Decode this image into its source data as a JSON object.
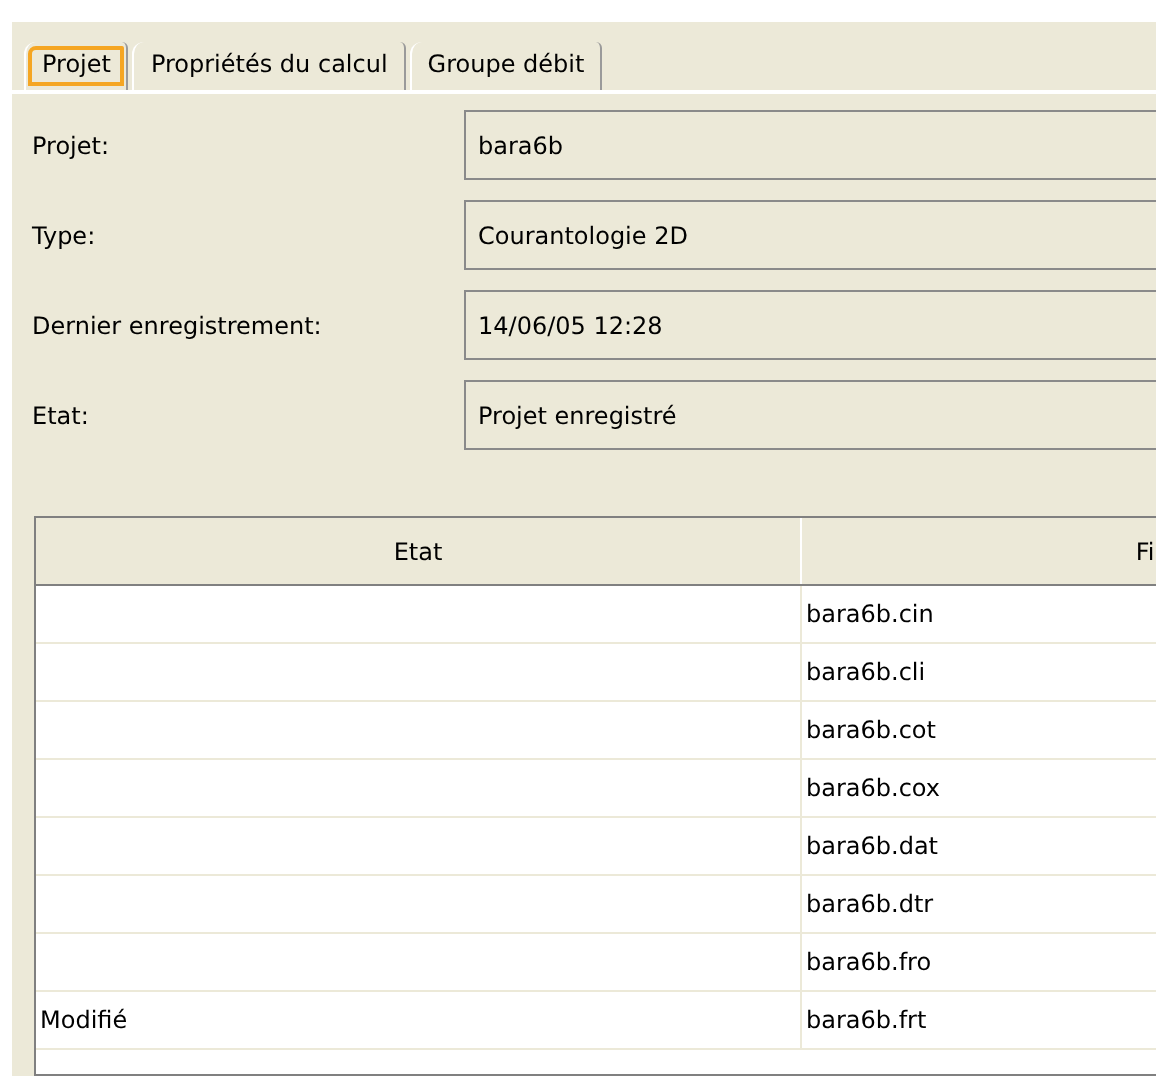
{
  "tabs": [
    {
      "label": "Projet",
      "selected": true
    },
    {
      "label": "Propriétés du calcul",
      "selected": false
    },
    {
      "label": "Groupe débit",
      "selected": false
    }
  ],
  "fields": [
    {
      "label": "Projet:",
      "value": "bara6b"
    },
    {
      "label": "Type:",
      "value": "Courantologie 2D"
    },
    {
      "label": "Dernier enregistrement:",
      "value": "14/06/05 12:28"
    },
    {
      "label": "Etat:",
      "value": "Projet enregistré"
    }
  ],
  "table": {
    "columns": [
      "Etat",
      "Fi"
    ],
    "rows": [
      [
        "",
        "bara6b.cin"
      ],
      [
        "",
        "bara6b.cli"
      ],
      [
        "",
        "bara6b.cot"
      ],
      [
        "",
        "bara6b.cox"
      ],
      [
        "",
        "bara6b.dat"
      ],
      [
        "",
        "bara6b.dtr"
      ],
      [
        "",
        "bara6b.fro"
      ],
      [
        "Modifié",
        "bara6b.frt"
      ]
    ]
  }
}
